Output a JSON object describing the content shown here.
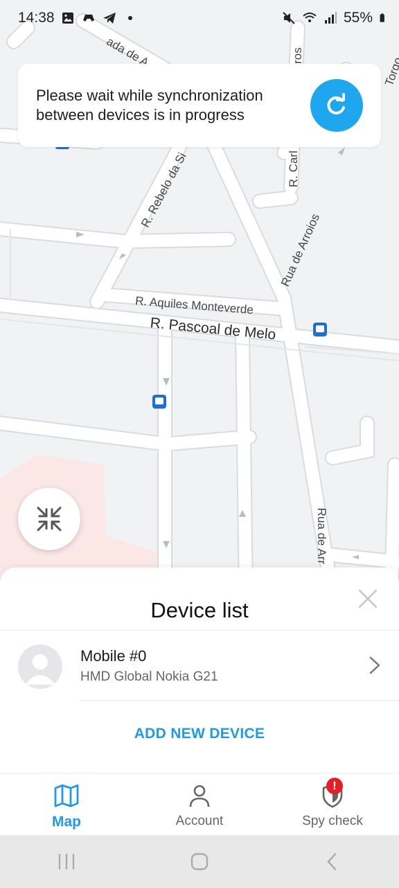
{
  "status_bar": {
    "time": "14:38",
    "battery": "55%",
    "icons": [
      "image-icon",
      "game-controller-icon",
      "telegram-icon",
      "dot-icon",
      "mute-icon",
      "wifi-icon",
      "signal-icon",
      "battery-icon"
    ]
  },
  "map": {
    "streets": [
      "R. Pascoal de Melo",
      "R. Aquiles Monteverde",
      "R. Rebelo da Si",
      "Rua de Arroios",
      "R. Carl",
      "ada de A",
      "ros",
      "Torgo",
      "Rua de Arr"
    ]
  },
  "sync_card": {
    "message": "Please wait while synchronization between devices is in progress",
    "button_icon": "refresh-icon"
  },
  "collapse_button": {
    "icon": "collapse-arrows-icon"
  },
  "device_sheet": {
    "title": "Device list",
    "devices": [
      {
        "name": "Mobile #0",
        "model": "HMD Global Nokia G21"
      }
    ],
    "add_label": "ADD NEW DEVICE"
  },
  "bottom_nav": {
    "items": [
      {
        "label": "Map",
        "icon": "map-icon",
        "active": true
      },
      {
        "label": "Account",
        "icon": "account-icon",
        "active": false
      },
      {
        "label": "Spy check",
        "icon": "shield-icon",
        "active": false,
        "badge": "!"
      }
    ]
  },
  "colors": {
    "accent": "#2199e5",
    "sync_button": "#1ea6ef",
    "badge": "#e3202a",
    "map_background": "#f1f2f4"
  }
}
